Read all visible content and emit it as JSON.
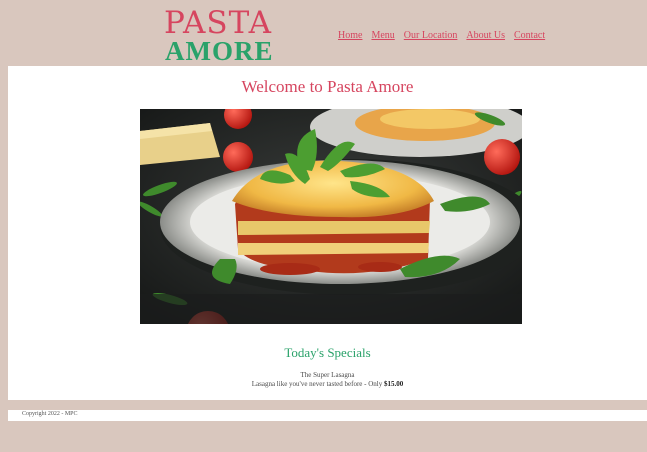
{
  "brand": {
    "logo_top": "PASTA",
    "logo_bottom": "AMORE"
  },
  "nav": {
    "items": [
      "Home",
      "Menu",
      "Our Location",
      "About Us",
      "Contact"
    ]
  },
  "main": {
    "heading": "Welcome to Pasta Amore",
    "hero_image_icon": "lasagna-photo"
  },
  "specials": {
    "title": "Today's Specials",
    "item_name": "The Super Lasagna",
    "item_desc": "Lasagna like you've never tasted before - Only ",
    "item_price": "$15.00"
  },
  "footer": {
    "copyright": "Copyright 2022 - MPC"
  },
  "colors": {
    "accent_red": "#d6455f",
    "accent_green": "#2aa26a",
    "header_bg": "#d9c7be"
  }
}
